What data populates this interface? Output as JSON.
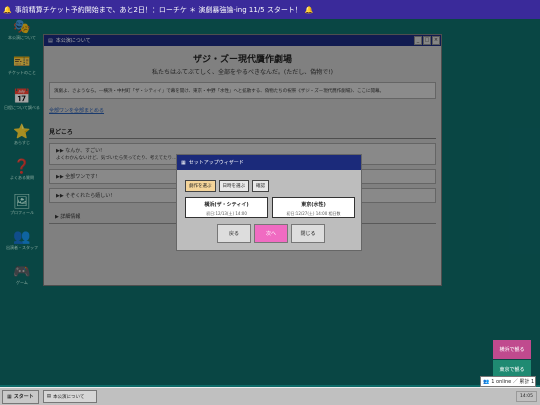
{
  "topbar": {
    "icon_left": "bell-icon",
    "text": "事前精算チケット予約開始まで、あと2日！：ローチケ ＊ 演劇暴強論-ing 11/5 スタート！",
    "icon_right": "bell-icon"
  },
  "desktop_icons": [
    {
      "label": "本公演について",
      "glyph": "theater"
    },
    {
      "label": "チケットのこと",
      "glyph": "ticket"
    },
    {
      "label": "日程について調べる",
      "glyph": "calendar"
    },
    {
      "label": "あらすじ",
      "glyph": "star"
    },
    {
      "label": "よくある質問",
      "glyph": "question"
    },
    {
      "label": "プロフィール",
      "glyph": "picture"
    },
    {
      "label": "出演者・スタッフ",
      "glyph": "people"
    },
    {
      "label": "ゲーム",
      "glyph": "gamepad"
    }
  ],
  "window": {
    "title": "本公演について",
    "heading": "ザジ・ズー現代贋作劇場",
    "tagline": "私たちはふてぶてしく、全部をやるべきなんだ。(ただし、偽物で!)",
    "intro": "演劇よ、さようなら。―横浜・中村町「ザ・シティイ」で幕を開け、東京・中野「水性」へと拡散する、偽物たちの祝祭《ザジ・ズー現代贋作劇場》、ここに開幕。",
    "link": "全部ワンを全部まとめる",
    "section": "見どころ",
    "accordions": [
      {
        "title": "▶▶ なんか、すごい!",
        "sub": "よくわかんないけど、気づいたら笑ってたり、考えてたり…"
      },
      {
        "title": "▶▶ 全部ワンです!",
        "sub": ""
      },
      {
        "title": "▶▶ そぞくれたら嬉しい!",
        "sub": ""
      }
    ],
    "details": "▶ 詳細情報"
  },
  "dialog": {
    "title": "セットアップウィザード",
    "tabs": [
      "劇作を選ぶ",
      "日時を選ぶ",
      "確認"
    ],
    "options": [
      {
        "name": "横浜(ザ・シティイ)",
        "date": "初日:12/13(土) 14:00"
      },
      {
        "name": "東京(水性)",
        "date": "初日:12/27(土) 14:00 相日数"
      }
    ],
    "buttons": {
      "back": "戻る",
      "next": "次へ",
      "close": "閉じる"
    }
  },
  "side_buttons": {
    "yokohama": "横浜で観る",
    "tokyo": "東京で観る"
  },
  "online": {
    "label": "1 online ／ 累計 1"
  },
  "taskbar": {
    "start": "スタート",
    "task": "本公演について",
    "clock": "14:05"
  },
  "colors": {
    "accent_pink": "#f06bc2",
    "title_blue": "#1b2a7a",
    "desktop": "#0e6b68"
  }
}
